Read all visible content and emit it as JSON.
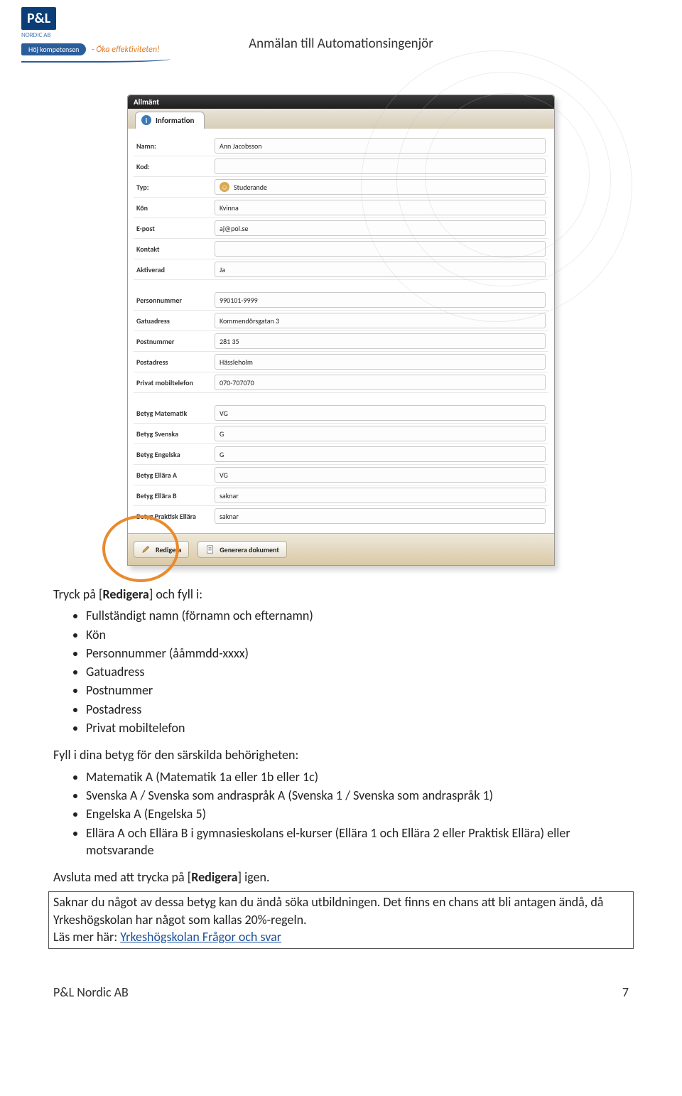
{
  "header": {
    "logo_text": "P&L",
    "logo_sub": "NORDIC AB",
    "banner_blue": "Höj kompetensen",
    "banner_orange": "- Öka effektiviteten!",
    "doc_title": "Anmälan till Automationsingenjör"
  },
  "panel": {
    "barTitle": "Allmänt",
    "tabLabel": "Information",
    "groups": [
      [
        {
          "label": "Namn:",
          "value": "Ann Jacobsson",
          "icon": null
        },
        {
          "label": "Kod:",
          "value": "",
          "icon": null
        },
        {
          "label": "Typ:",
          "value": "Studerande",
          "icon": "student"
        },
        {
          "label": "Kön",
          "value": "Kvinna",
          "icon": null
        },
        {
          "label": "E-post",
          "value": "aj@pol.se",
          "icon": null
        },
        {
          "label": "Kontakt",
          "value": "",
          "icon": null
        },
        {
          "label": "Aktiverad",
          "value": "Ja",
          "icon": null
        }
      ],
      [
        {
          "label": "Personnummer",
          "value": "990101-9999",
          "icon": null
        },
        {
          "label": "Gatuadress",
          "value": "Kommendörsgatan 3",
          "icon": null
        },
        {
          "label": "Postnummer",
          "value": "281 35",
          "icon": null
        },
        {
          "label": "Postadress",
          "value": "Hässleholm",
          "icon": null
        },
        {
          "label": "Privat mobiltelefon",
          "value": "070-707070",
          "icon": null
        }
      ],
      [
        {
          "label": "Betyg Matematik",
          "value": "VG",
          "icon": null
        },
        {
          "label": "Betyg Svenska",
          "value": "G",
          "icon": null
        },
        {
          "label": "Betyg Engelska",
          "value": "G",
          "icon": null
        },
        {
          "label": "Betyg Ellära A",
          "value": "VG",
          "icon": null
        },
        {
          "label": "Betyg Ellära B",
          "value": "saknar",
          "icon": null
        },
        {
          "label": "Betyg Praktisk Ellära",
          "value": "saknar",
          "icon": null
        }
      ]
    ],
    "buttons": {
      "edit": "Redigera",
      "gen": "Generera dokument"
    }
  },
  "body": {
    "intro_pre": "Tryck på [",
    "intro_bold1": "Redigera",
    "intro_post": "] och fyll i:",
    "list1": [
      "Fullständigt namn (förnamn och efternamn)",
      "Kön",
      "Personnummer (ååmmdd-xxxx)",
      "Gatuadress",
      "Postnummer",
      "Postadress",
      "Privat mobiltelefon"
    ],
    "mid": "Fyll i dina betyg för den särskilda behörigheten:",
    "list2": [
      "Matematik A (Matematik 1a eller 1b eller 1c)",
      "Svenska A / Svenska som andraspråk A (Svenska 1 / Svenska som andraspråk 1)",
      "Engelska A (Engelska 5)",
      "Ellära A och Ellära B i gymnasieskolans el-kurser (Ellära 1 och Ellära 2 eller Praktisk Ellära) eller motsvarande"
    ],
    "end_pre": "Avsluta med att trycka på [",
    "end_bold": "Redigera",
    "end_post": "] igen.",
    "note_l1": "Saknar du något av dessa betyg kan du ändå söka utbildningen. Det finns en chans att bli antagen ändå, då Yrkeshögskolan har något som kallas 20%-regeln.",
    "note_l2_pre": "Läs mer här: ",
    "note_link": "Yrkeshögskolan Frågor och svar"
  },
  "footer": {
    "left": "P&L Nordic AB",
    "right": "7"
  }
}
